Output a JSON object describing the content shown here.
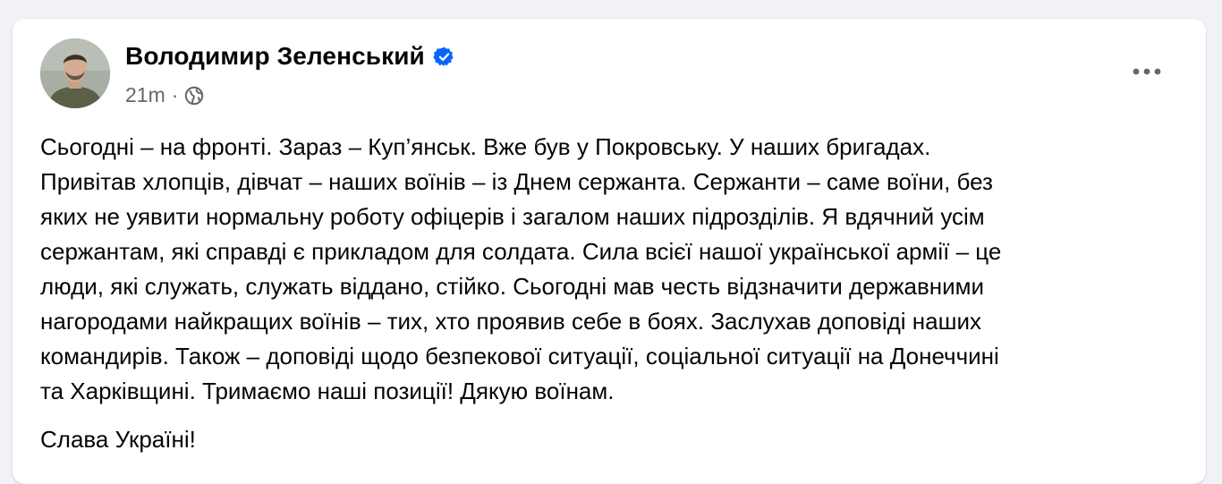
{
  "post": {
    "author": "Володимир Зеленський",
    "verified": true,
    "time": "21m",
    "separator": "·",
    "audience_icon": "globe-icon",
    "more_icon": "more-horizontal-icon",
    "lines": [
      "Сьогодні – на фронті. Зараз – Куп’янськ. Вже був у Покровську. У наших бригадах.",
      "Привітав хлопців, дівчат – наших воїнів – із Днем сержанта. Сержанти – саме воїни, без",
      "яких не уявити нормальну роботу офіцерів і загалом наших підрозділів. Я вдячний усім",
      "сержантам, які справді є прикладом для солдата. Сила всієї нашої української армії – це",
      "люди, які служать, служать віддано, стійко. Сьогодні мав честь відзначити державними",
      "нагородами найкращих воїнів – тих, хто проявив себе в боях. Заслухав доповіді наших",
      "командирів. Також – доповіді щодо безпекової ситуації, соціальної ситуації на Донеччині",
      "та Харківщині. Тримаємо наші позиції! Дякую воїнам."
    ],
    "closing": "Слава Україні!"
  },
  "colors": {
    "page_bg": "#f0f2f5",
    "card_bg": "#ffffff",
    "text": "#050505",
    "secondary_text": "#65676b",
    "verified_blue": "#0866ff"
  }
}
